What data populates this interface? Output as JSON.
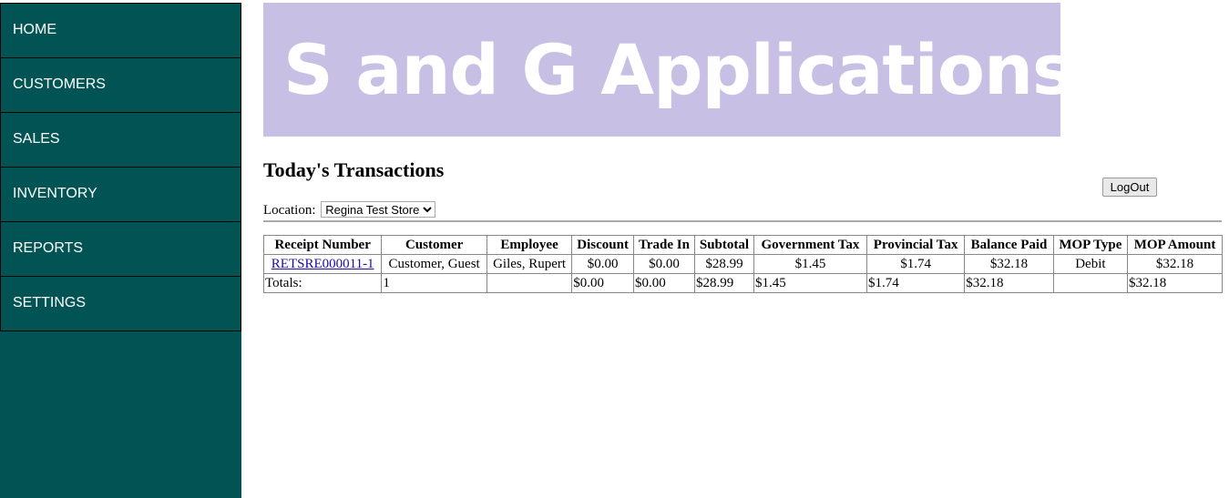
{
  "nav": [
    "HOME",
    "CUSTOMERS",
    "SALES",
    "INVENTORY",
    "REPORTS",
    "SETTINGS"
  ],
  "banner": "S and G Applications",
  "title": "Today's Transactions",
  "logout": "LogOut",
  "location": {
    "label": "Location:",
    "selected": "Regina Test Store"
  },
  "table": {
    "headers": [
      "Receipt Number",
      "Customer",
      "Employee",
      "Discount",
      "Trade In",
      "Subtotal",
      "Government Tax",
      "Provincial Tax",
      "Balance Paid",
      "MOP Type",
      "MOP Amount"
    ],
    "row": [
      "RETSRE000011-1",
      "Customer, Guest",
      "Giles, Rupert",
      "$0.00",
      "$0.00",
      "$28.99",
      "$1.45",
      "$1.74",
      "$32.18",
      "Debit",
      "$32.18"
    ],
    "totals": [
      "Totals:",
      "1",
      "",
      "$0.00",
      "$0.00",
      "$28.99",
      "$1.45",
      "$1.74",
      "$32.18",
      "",
      "$32.18"
    ]
  }
}
